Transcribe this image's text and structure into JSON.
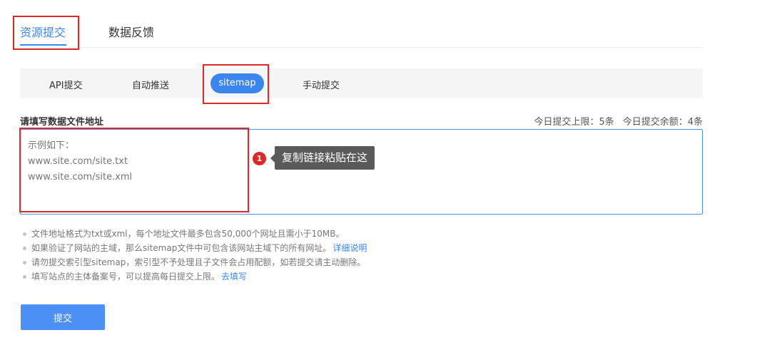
{
  "tabs": {
    "items": [
      "资源提交",
      "数据反馈"
    ]
  },
  "subnav": {
    "items": [
      "API提交",
      "自动推送",
      "sitemap",
      "手动提交"
    ]
  },
  "form": {
    "label": "请填写数据文件地址",
    "quota_limit": "今日提交上限：5条",
    "quota_remaining": "今日提交余额：4条",
    "placeholder": "示例如下：\nwww.site.com/site.txt\nwww.site.com/site.xml"
  },
  "callout": {
    "number": "1",
    "text": "复制链接粘贴在这"
  },
  "notes": [
    {
      "text": "文件地址格式为txt或xml，每个地址文件最多包含50,000个网址且需小于10MB。",
      "link": ""
    },
    {
      "text": "如果验证了网站的主域，那么sitemap文件中可包含该网站主域下的所有网址。",
      "link": "详细说明"
    },
    {
      "text": "请勿提交索引型sitemap，索引型不予处理且子文件会占用配额，如若提交请主动删除。",
      "link": ""
    },
    {
      "text": "填写站点的主体备案号，可以提高每日提交上限。",
      "link": "去填写"
    }
  ],
  "submit_label": "提交",
  "colors": {
    "accent": "#3b86ee",
    "highlight": "#e02727",
    "callout_bg": "#5a5a5a"
  }
}
